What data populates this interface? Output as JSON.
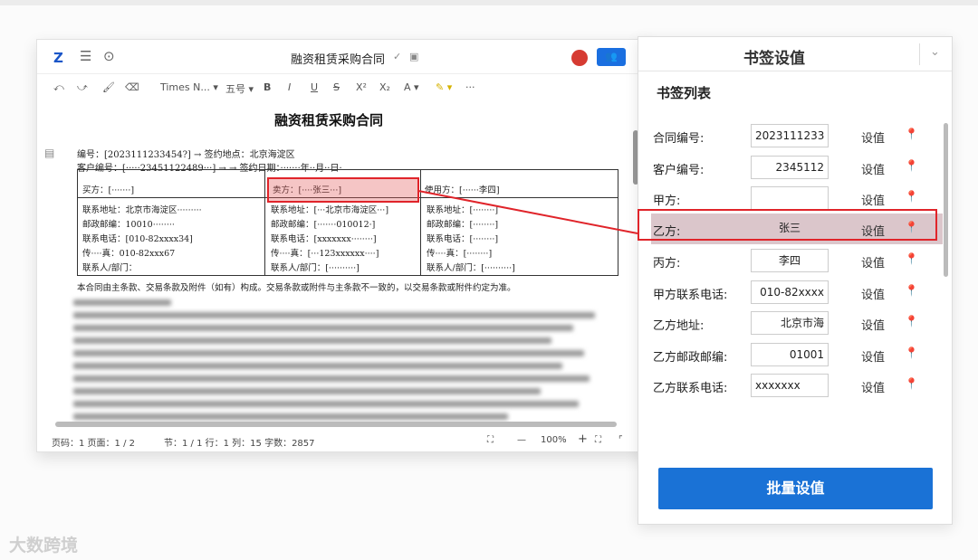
{
  "editor": {
    "doc_title": "融资租赁采购合同",
    "toolbar": {
      "undo": "⤺",
      "redo": "⤻",
      "format_painter": "🖌",
      "clear": "⌫",
      "font": "Times N... ▾",
      "size": "五号 ▾",
      "bold": "B",
      "italic": "I",
      "underline": "U",
      "strike": "S",
      "sup": "X²",
      "sub": "X₂",
      "font_color": "A ▾",
      "highlight": "✎ ▾",
      "more": "···"
    },
    "doc": {
      "heading": "融资租赁采购合同",
      "line1": "编号：[2023111233454?] → 签约地点：北京海淀区",
      "line2": "客户编号：[·····23451122489···] → → 签约日期：·······年··月··日·",
      "buyer": "买方：[·······]",
      "seller": "卖方：[····张三···]",
      "user": "使用方：[······李四]",
      "col1": [
        "联系地址：北京市海淀区·········",
        "邮政邮编：10010········",
        "联系电话：[010-82xxxx34]",
        "传····真：010-82xxx67",
        "联系人/部门："
      ],
      "col2": [
        "联系地址：[···北京市海淀区···]",
        "邮政邮编：[·······010012·]",
        "联系电话：[xxxxxxx········]",
        "传····真：[···123xxxxxx····]",
        "联系人/部门：[··········]"
      ],
      "col3": [
        "联系地址：[········]",
        "邮政邮编：[········]",
        "联系电话：[········]",
        "传····真：[········]",
        "联系人/部门：[··········]"
      ],
      "note": "本合同由主条款、交易条款及附件（如有）构成。交易条款或附件与主条款不一致的，以交易条款或附件约定为准。"
    },
    "status": {
      "page": "页码：1  页面：1 / 2",
      "section": "节：1 / 1  行：1  列：15  字数：2857",
      "zoom": "100%",
      "minus": "—",
      "plus": "+"
    }
  },
  "panel": {
    "title": "书签设值",
    "list_title": "书签列表",
    "set_label": "设值",
    "rows": [
      {
        "label": "合同编号:",
        "value": "2023111233"
      },
      {
        "label": "客户编号:",
        "value": "2345112"
      },
      {
        "label": "甲方:",
        "value": ""
      },
      {
        "label": "乙方:",
        "value": "张三"
      },
      {
        "label": "丙方:",
        "value": "李四"
      },
      {
        "label": "甲方联系电话:",
        "value": "010-82xxxx"
      },
      {
        "label": "乙方地址:",
        "value": "北京市海"
      },
      {
        "label": "乙方邮政邮编:",
        "value": "01001"
      },
      {
        "label": "乙方联系电话:",
        "value": "xxxxxxx"
      }
    ],
    "batch_button": "批量设值"
  },
  "watermark": "大数跨境",
  "colors": {
    "accent": "#1a72d6",
    "highlight_red": "#e0242a"
  }
}
